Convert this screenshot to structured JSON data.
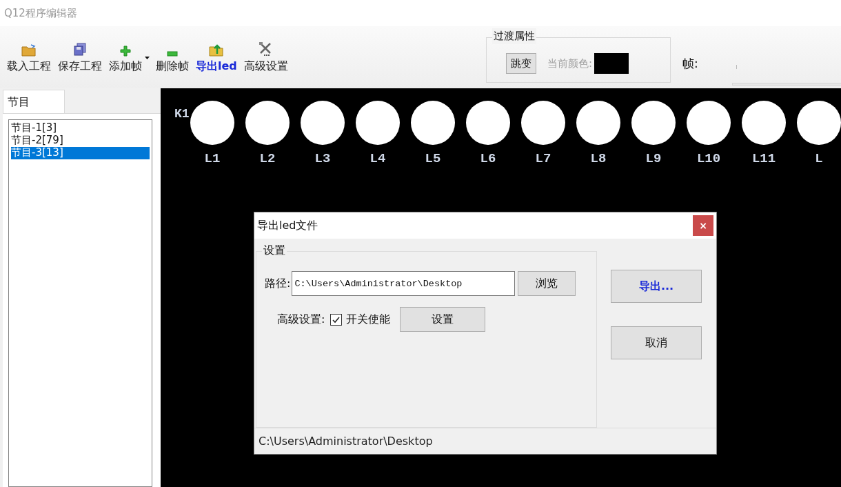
{
  "window": {
    "title": "Q12程序编辑器"
  },
  "toolbar": [
    {
      "label": "载入工程",
      "kind": "folder",
      "highlighted": false,
      "dropdown": false
    },
    {
      "label": "保存工程",
      "kind": "save",
      "highlighted": false,
      "dropdown": false
    },
    {
      "label": "添加帧",
      "kind": "add",
      "highlighted": false,
      "dropdown": true
    },
    {
      "label": "删除帧",
      "kind": "remove",
      "highlighted": false,
      "dropdown": false
    },
    {
      "label": "导出led",
      "kind": "export",
      "highlighted": true,
      "dropdown": false
    },
    {
      "label": "高级设置",
      "kind": "tools",
      "highlighted": false,
      "dropdown": false
    }
  ],
  "transition": {
    "title": "过渡属性",
    "mode_button": "跳变",
    "color_label": "当前颜色:",
    "color": "#000000"
  },
  "frame": {
    "label": "帧:"
  },
  "side_tabs": [
    {
      "label": "节目",
      "selected": true
    }
  ],
  "programs": [
    {
      "label": "节目-1[3]",
      "selected": false
    },
    {
      "label": "节目-2[79]",
      "selected": false
    },
    {
      "label": "节目-3[13]",
      "selected": true
    }
  ],
  "canvas": {
    "row_label": "K1",
    "leds": [
      {
        "label": "L1"
      },
      {
        "label": "L2"
      },
      {
        "label": "L3"
      },
      {
        "label": "L4"
      },
      {
        "label": "L5"
      },
      {
        "label": "L6"
      },
      {
        "label": "L7"
      },
      {
        "label": "L8"
      },
      {
        "label": "L9"
      },
      {
        "label": "L10"
      },
      {
        "label": "L11"
      },
      {
        "label": "L"
      }
    ]
  },
  "dialog": {
    "title": "导出led文件",
    "close": "×",
    "group": "设置",
    "path_label": "路径:",
    "path_value": "C:\\Users\\Administrator\\Desktop",
    "browse": "浏览",
    "advanced_label": "高级设置:",
    "enable": {
      "label": "开关使能",
      "checked": true
    },
    "settings_button": "设置",
    "export_button": "导出...",
    "cancel_button": "取消",
    "status": "C:\\Users\\Administrator\\Desktop"
  }
}
